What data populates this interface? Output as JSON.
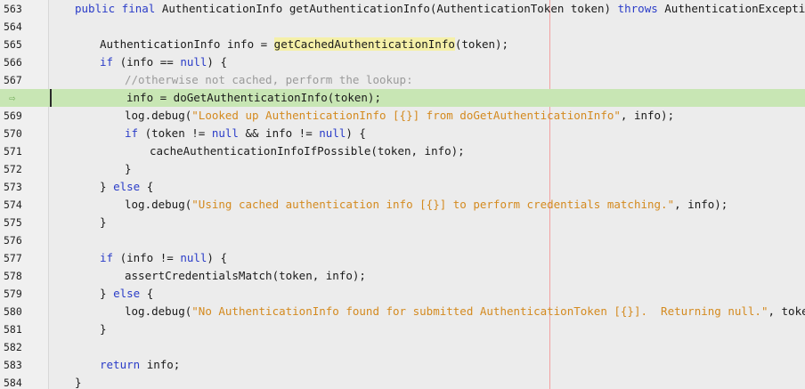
{
  "editor": {
    "lines": [
      {
        "no": "563",
        "indent": 2,
        "tokens": [
          [
            "kw",
            "public final "
          ],
          [
            "",
            "AuthenticationInfo getAuthenticationInfo(AuthenticationToken token) "
          ],
          [
            "kw",
            "throws "
          ],
          [
            "",
            "AuthenticationException {"
          ]
        ]
      },
      {
        "no": "564",
        "indent": 0,
        "tokens": []
      },
      {
        "no": "565",
        "indent": 4,
        "tokens": [
          [
            "",
            "AuthenticationInfo info = "
          ],
          [
            "hl",
            "getCachedAuthenticationInfo"
          ],
          [
            "",
            "(token);"
          ]
        ]
      },
      {
        "no": "566",
        "indent": 4,
        "tokens": [
          [
            "kw",
            "if "
          ],
          [
            "",
            "(info == "
          ],
          [
            "kw",
            "null"
          ],
          [
            "",
            ") {"
          ]
        ]
      },
      {
        "no": "567",
        "indent": 6,
        "tokens": [
          [
            "cmt",
            "//otherwise not cached, perform the lookup:"
          ]
        ]
      },
      {
        "no": "",
        "current": true,
        "indent": 6,
        "tokens": [
          [
            "",
            "info = doGetAuthenticationInfo(token);"
          ]
        ]
      },
      {
        "no": "569",
        "indent": 6,
        "tokens": [
          [
            "",
            "log.debug("
          ],
          [
            "str",
            "\"Looked up AuthenticationInfo [{}] from doGetAuthenticationInfo\""
          ],
          [
            "",
            ", info);"
          ]
        ]
      },
      {
        "no": "570",
        "indent": 6,
        "tokens": [
          [
            "kw",
            "if "
          ],
          [
            "",
            "(token != "
          ],
          [
            "kw",
            "null"
          ],
          [
            "",
            " && info != "
          ],
          [
            "kw",
            "null"
          ],
          [
            "",
            ") {"
          ]
        ]
      },
      {
        "no": "571",
        "indent": 8,
        "tokens": [
          [
            "",
            "cacheAuthenticationInfoIfPossible(token, info);"
          ]
        ]
      },
      {
        "no": "572",
        "indent": 6,
        "tokens": [
          [
            "",
            "}"
          ]
        ]
      },
      {
        "no": "573",
        "indent": 4,
        "tokens": [
          [
            "",
            "} "
          ],
          [
            "kw",
            "else "
          ],
          [
            "",
            "{"
          ]
        ]
      },
      {
        "no": "574",
        "indent": 6,
        "tokens": [
          [
            "",
            "log.debug("
          ],
          [
            "str",
            "\"Using cached authentication info [{}] to perform credentials matching.\""
          ],
          [
            "",
            ", info);"
          ]
        ]
      },
      {
        "no": "575",
        "indent": 4,
        "tokens": [
          [
            "",
            "}"
          ]
        ]
      },
      {
        "no": "576",
        "indent": 0,
        "tokens": []
      },
      {
        "no": "577",
        "indent": 4,
        "tokens": [
          [
            "kw",
            "if "
          ],
          [
            "",
            "(info != "
          ],
          [
            "kw",
            "null"
          ],
          [
            "",
            ") {"
          ]
        ]
      },
      {
        "no": "578",
        "indent": 6,
        "tokens": [
          [
            "",
            "assertCredentialsMatch(token, info);"
          ]
        ]
      },
      {
        "no": "579",
        "indent": 4,
        "tokens": [
          [
            "",
            "} "
          ],
          [
            "kw",
            "else "
          ],
          [
            "",
            "{"
          ]
        ]
      },
      {
        "no": "580",
        "indent": 6,
        "tokens": [
          [
            "",
            "log.debug("
          ],
          [
            "str",
            "\"No AuthenticationInfo found for submitted AuthenticationToken [{}].  Returning null.\""
          ],
          [
            "",
            ", token);"
          ]
        ]
      },
      {
        "no": "581",
        "indent": 4,
        "tokens": [
          [
            "",
            "}"
          ]
        ]
      },
      {
        "no": "582",
        "indent": 0,
        "tokens": []
      },
      {
        "no": "583",
        "indent": 4,
        "tokens": [
          [
            "kw",
            "return "
          ],
          [
            "",
            "info;"
          ]
        ]
      },
      {
        "no": "584",
        "indent": 2,
        "tokens": [
          [
            "",
            "}"
          ]
        ]
      }
    ],
    "current_line_marker": "⇨"
  }
}
